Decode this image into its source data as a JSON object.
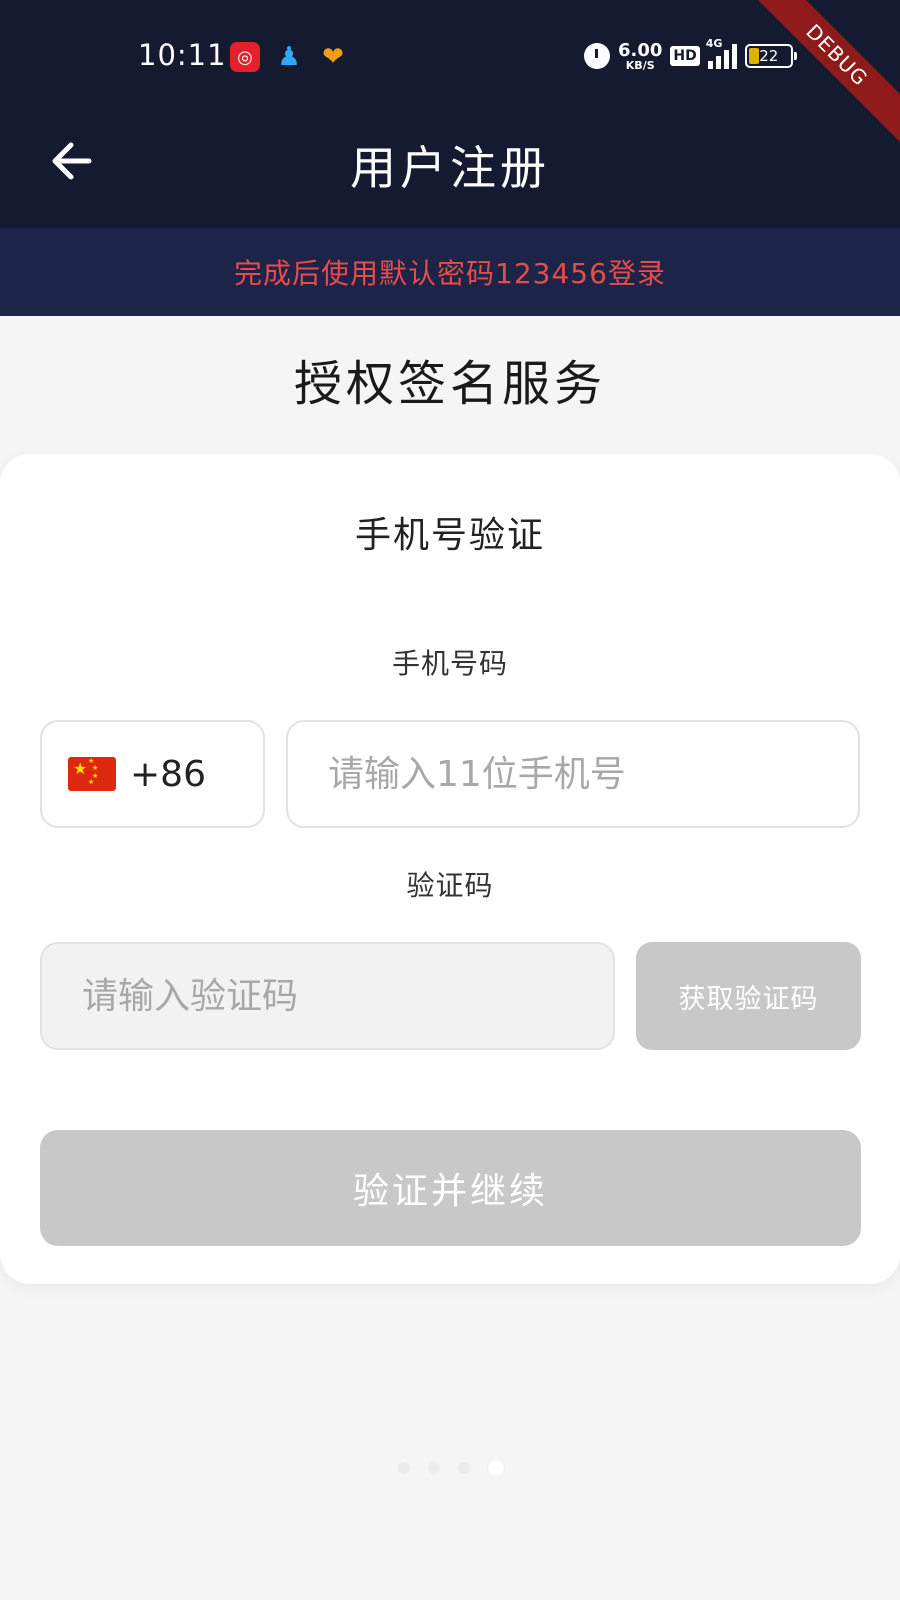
{
  "status_bar": {
    "time": "10:11",
    "network_speed_value": "6.00",
    "network_speed_unit": "KB/S",
    "hd_label": "HD",
    "network_type": "4G",
    "battery_level": "22",
    "debug_label": "DEBUG"
  },
  "header": {
    "title": "用户注册",
    "back_icon": "arrow-left-icon"
  },
  "notice": {
    "text": "完成后使用默认密码123456登录",
    "color": "#e84b4b"
  },
  "service_title": "授权签名服务",
  "form": {
    "title": "手机号验证",
    "phone_label": "手机号码",
    "country_code": "+86",
    "country_flag_icon": "china-flag-icon",
    "phone_placeholder": "请输入11位手机号",
    "code_label": "验证码",
    "code_placeholder": "请输入验证码",
    "get_code_label": "获取验证码",
    "submit_label": "验证并继续"
  },
  "pagination": {
    "total": 4,
    "active_index": 3
  },
  "colors": {
    "header_bg": "#141a2f",
    "notice_bg": "#1c2547",
    "disabled_button": "#c8c8c8"
  }
}
